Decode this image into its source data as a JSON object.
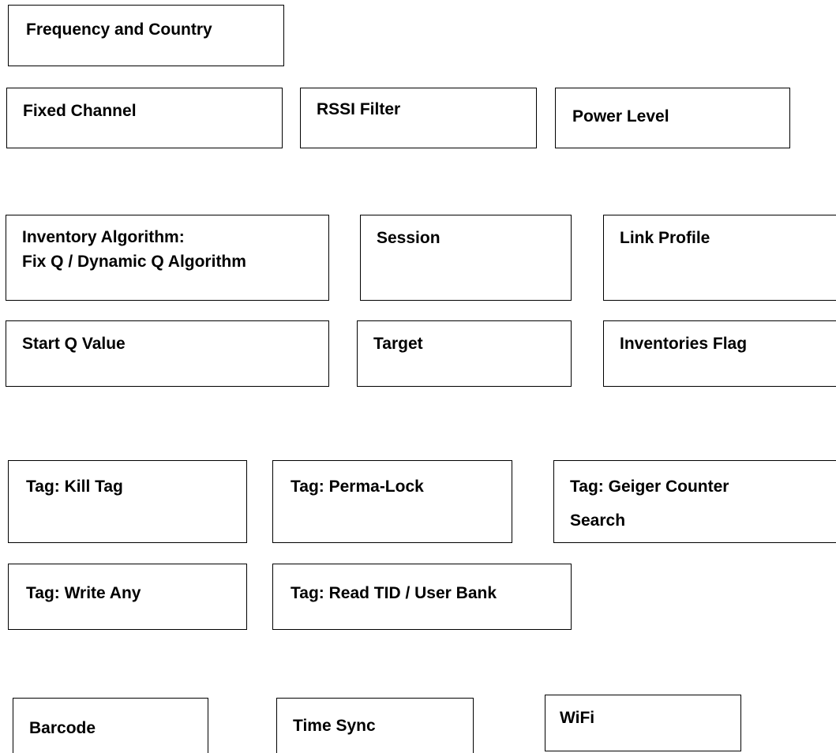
{
  "boxes": {
    "frequency_country": "Frequency and Country",
    "fixed_channel": "Fixed Channel",
    "rssi_filter": "RSSI Filter",
    "power_level": "Power Level",
    "inventory_algorithm_1": "Inventory Algorithm:",
    "inventory_algorithm_2": "Fix Q / Dynamic Q Algorithm",
    "session": "Session",
    "link_profile": "Link Profile",
    "start_q": "Start Q Value",
    "target": "Target",
    "inventories_flag": "Inventories Flag",
    "kill_tag": "Tag: Kill Tag",
    "perma_lock": "Tag: Perma-Lock",
    "geiger_1": "Tag: Geiger Counter",
    "geiger_2": "Search",
    "write_any": "Tag: Write Any",
    "read_tid": "Tag: Read TID / User Bank",
    "barcode": "Barcode",
    "time_sync": "Time Sync",
    "wifi": "WiFi"
  }
}
